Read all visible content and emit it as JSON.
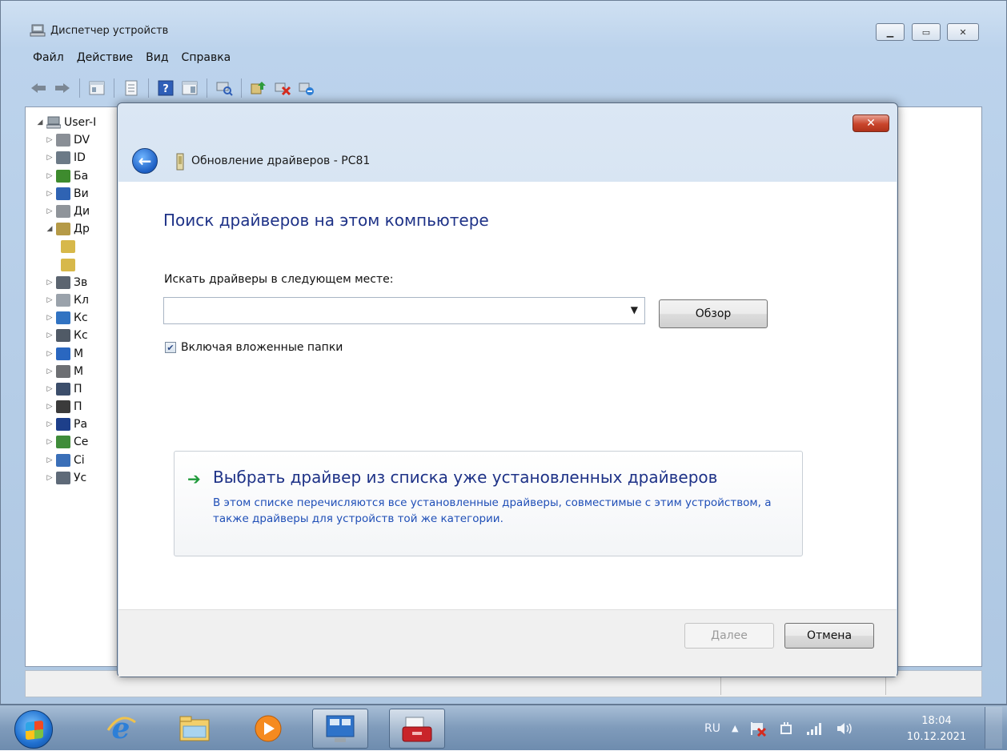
{
  "window": {
    "title": "Диспетчер устройств",
    "menu": [
      "Файл",
      "Действие",
      "Вид",
      "Справка"
    ],
    "toolbar_icons": [
      "back-arrow-icon",
      "forward-arrow-icon",
      "console-tree-icon",
      "properties-icon",
      "help-icon",
      "view-icon",
      "scan-hardware-icon",
      "update-driver-icon",
      "uninstall-device-icon",
      "disable-device-icon"
    ]
  },
  "tree": {
    "root": "User-I",
    "items": [
      {
        "label": "DV",
        "icon": "dvd-drive-icon",
        "color": "#8a8f96"
      },
      {
        "label": "ID",
        "icon": "ide-controller-icon",
        "color": "#6c7a87"
      },
      {
        "label": "Ба",
        "icon": "battery-icon",
        "color": "#3e8b2e"
      },
      {
        "label": "Ви",
        "icon": "video-adapter-icon",
        "color": "#2f63b3"
      },
      {
        "label": "Ди",
        "icon": "disk-drive-icon",
        "color": "#8f949a"
      },
      {
        "label": "Др",
        "icon": "other-devices-icon",
        "color": "#b59a47",
        "expanded": true
      },
      {
        "label": "",
        "icon": "unknown-device-icon",
        "color": "#d7b84a",
        "child": true
      },
      {
        "label": "",
        "icon": "unknown-device-icon",
        "color": "#d7b84a",
        "child": true
      },
      {
        "label": "Зв",
        "icon": "sound-icon",
        "color": "#5b6470"
      },
      {
        "label": "Кл",
        "icon": "keyboard-icon",
        "color": "#9aa2ab"
      },
      {
        "label": "Кс",
        "icon": "computer-icon",
        "color": "#3173c2"
      },
      {
        "label": "Кс",
        "icon": "usb-controller-icon",
        "color": "#505a66"
      },
      {
        "label": "М",
        "icon": "monitor-icon",
        "color": "#2a67c0"
      },
      {
        "label": "М",
        "icon": "mouse-icon",
        "color": "#6d6f73"
      },
      {
        "label": "П",
        "icon": "portable-device-icon",
        "color": "#3c4e6b"
      },
      {
        "label": "П",
        "icon": "processor-icon",
        "color": "#3b3b3b"
      },
      {
        "label": "Ра",
        "icon": "bluetooth-icon",
        "color": "#1d3f8a"
      },
      {
        "label": "Се",
        "icon": "network-adapter-icon",
        "color": "#3f8c3a"
      },
      {
        "label": "Сі",
        "icon": "system-devices-icon",
        "color": "#3a6fb8"
      },
      {
        "label": "Ус",
        "icon": "imaging-devices-icon",
        "color": "#5e6a78"
      }
    ]
  },
  "dialog": {
    "title": "Обновление драйверов - PC81",
    "close_glyph": "✕",
    "heading": "Поиск драйверов на этом компьютере",
    "search_label": "Искать драйверы в следующем месте:",
    "path_value": "",
    "browse_label": "Обзор",
    "include_subfolders_label": "Включая вложенные папки",
    "include_subfolders_checked": true,
    "choice_title": "Выбрать драйвер из списка уже установленных драйверов",
    "choice_desc": "В этом списке перечисляются все установленные драйверы, совместимые с этим устройством, а также драйверы для устройств той же категории.",
    "next_label": "Далее",
    "cancel_label": "Отмена"
  },
  "taskbar": {
    "apps": [
      "internet-explorer-icon",
      "explorer-folder-icon",
      "media-player-icon",
      "device-manager-icon",
      "toolbox-icon"
    ],
    "tray": {
      "language": "RU",
      "time": "18:04",
      "date": "10.12.2021"
    }
  },
  "colors": {
    "heading": "#1e3287",
    "link": "#1f4fb7",
    "accent_green": "#1f9a3a"
  }
}
